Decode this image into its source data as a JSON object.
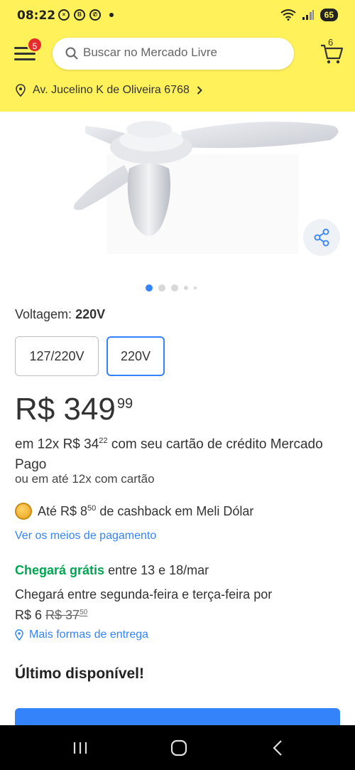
{
  "status_bar": {
    "time": "08:22",
    "battery": "65"
  },
  "header": {
    "menu_badge": "5",
    "search_placeholder": "Buscar no Mercado Livre",
    "cart_count": "6",
    "address": "Av. Jucelino K de Oliveira 6768"
  },
  "product": {
    "image_dots": 5,
    "active_dot": 0,
    "voltage_label": "Voltagem:",
    "voltage_selected": "220V",
    "voltage_options": [
      "127/220V",
      "220V"
    ]
  },
  "price": {
    "currency": "R$",
    "integer": "349",
    "cents": "99",
    "installment_prefix": "em 12x R$ 34",
    "installment_cents": "22",
    "installment_suffix": "com seu cartão de crédito Mercado Pago",
    "installment_alt": "ou em até 12x com cartão",
    "cashback_prefix": "Até R$ 8",
    "cashback_cents": "50",
    "cashback_suffix": "de cashback em Meli Dólar",
    "payment_link": "Ver os meios de pagamento"
  },
  "shipping": {
    "free_label": "Chegará grátis",
    "free_dates": "entre 13 e 18/mar",
    "paid_text": "Chegará entre segunda-feira e terça-feira por",
    "paid_price": "R$ 6",
    "paid_old_price": "R$ 37",
    "paid_old_cents": "50",
    "more_options": "Mais formas de entrega"
  },
  "stock": {
    "label": "Último disponível!"
  },
  "colors": {
    "brand_yellow": "#fff159",
    "accent_blue": "#3483fa",
    "green": "#00a650"
  }
}
